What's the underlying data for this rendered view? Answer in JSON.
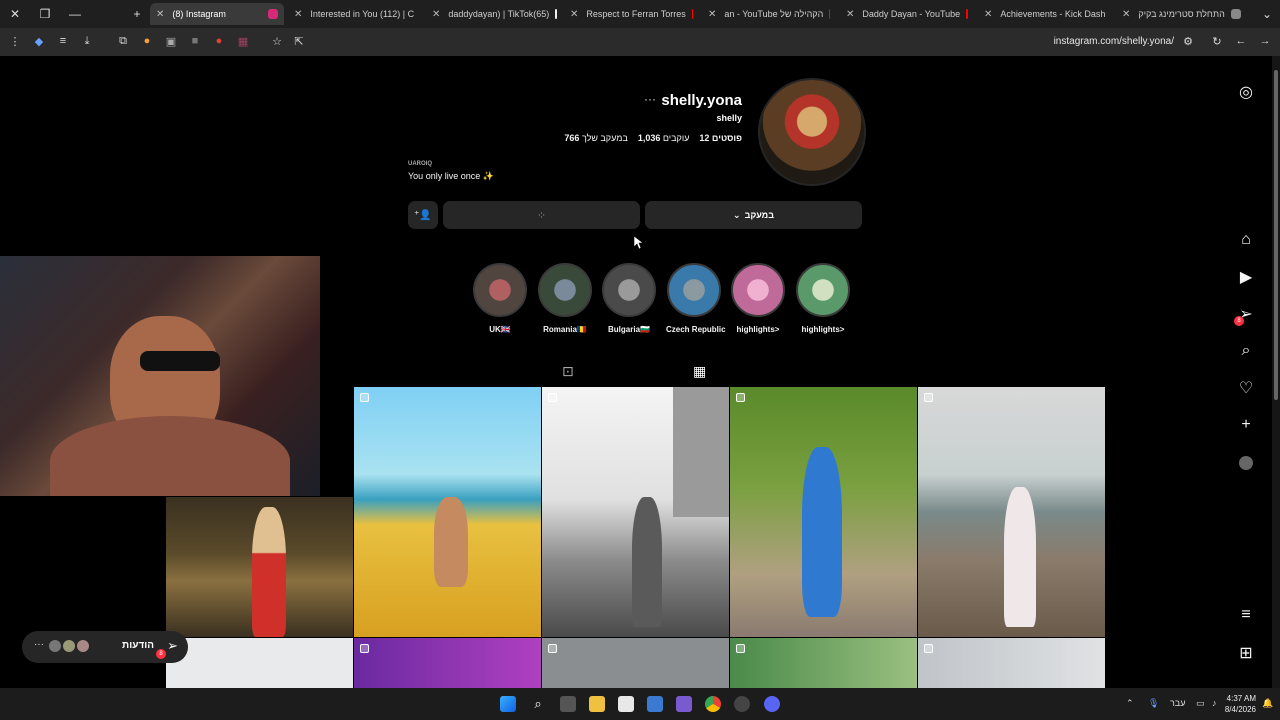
{
  "browser": {
    "tabs": [
      {
        "title": "(8) Instagram",
        "active": true
      },
      {
        "title": "Interested in You (112) | C",
        "active": false
      },
      {
        "title": "daddydayan) | TikTok(65)",
        "active": false
      },
      {
        "title": "Respect to Ferran Torres",
        "active": false
      },
      {
        "title": "an - YouTube הקהילה של",
        "active": false
      },
      {
        "title": "Daddy Dayan - YouTube",
        "active": false
      },
      {
        "title": "Achievements - Kick Dash",
        "active": false
      },
      {
        "title": "התחלת סטרימינג בקיק",
        "active": false
      }
    ],
    "url": "instagram.com/shelly.yona/"
  },
  "profile": {
    "username": "shelly.yona",
    "full_name": "shelly",
    "stats": {
      "posts_label": "12 פוסטים",
      "followers_count": "1,036",
      "followers_label": "עוקבים",
      "following_count": "766",
      "following_label": "במעקב שלך"
    },
    "bio_category": "UAROIQ",
    "bio_text": "You only live once ✨",
    "follow_button": "במעקב",
    "message_button_loading": "⁘",
    "suggest_icon": "⁺👤"
  },
  "highlights": [
    {
      "label": "UK🇬🇧",
      "color": "#8a4a4a"
    },
    {
      "label": "Romania🇷🇴",
      "color": "#4a5a6a"
    },
    {
      "label": "Bulgaria🇧🇬",
      "color": "#6a6a6a"
    },
    {
      "label": "Czech Republic",
      "color": "#3a6a8a"
    },
    {
      "label": "highlights>",
      "color": "#c06a9a"
    },
    {
      "label": "highlights>",
      "color": "#5a9a6a"
    }
  ],
  "messages_pill": {
    "label": "הודעות",
    "badge": "8"
  },
  "nav_badges": {
    "messages": "8"
  },
  "taskbar": {
    "lang": "עבר",
    "time": "4:37 AM",
    "date": "8/4/2026"
  }
}
